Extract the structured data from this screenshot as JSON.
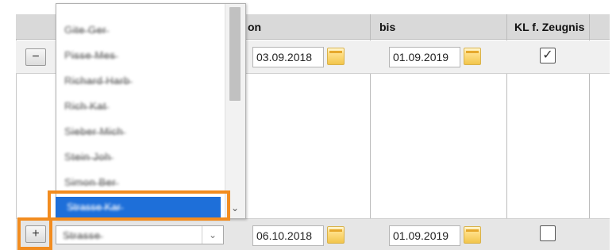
{
  "table": {
    "headers": {
      "col_name": "",
      "col_von": "on",
      "col_bis": "bis",
      "col_kl": "KL f. Zeugnis"
    },
    "rows": [
      {
        "button_label": "−",
        "name": "Pi̶s̶s̶e̶ ̶M̶e̶s̶",
        "von": "03.09.2018",
        "bis": "01.09.2019",
        "kl_checked": true,
        "checkmark": "✓"
      },
      {
        "button_label": "+",
        "name": "S̶t̶r̶a̶s̶s̶e̶",
        "von": "06.10.2018",
        "bis": "01.09.2019",
        "kl_checked": false,
        "checkmark": ""
      }
    ]
  },
  "dropdown": {
    "arrow_down": "⌄",
    "items": [
      "Gi̶t̶e̶ ̶G̶e̶r̶",
      "Pi̶s̶s̶e̶ ̶M̶e̶s̶",
      "Ri̶c̶h̶a̶r̶d̶ ̶H̶a̶r̶b̶",
      "Ri̶c̶h̶ ̶K̶a̶t̶",
      "Si̶e̶b̶e̶r̶ ̶M̶i̶c̶h̶",
      "St̶e̶i̶n̶ ̶J̶o̶h̶",
      "Si̶m̶o̶n̶ ̶B̶e̶r̶"
    ],
    "selected_item": "S̶t̶r̶a̶s̶s̶e̶ ̶K̶a̶r̶"
  },
  "colors": {
    "highlight_box": "#f28c1f",
    "selection_blue": "#1e6fd9",
    "header_gray": "#d9d9d9"
  }
}
